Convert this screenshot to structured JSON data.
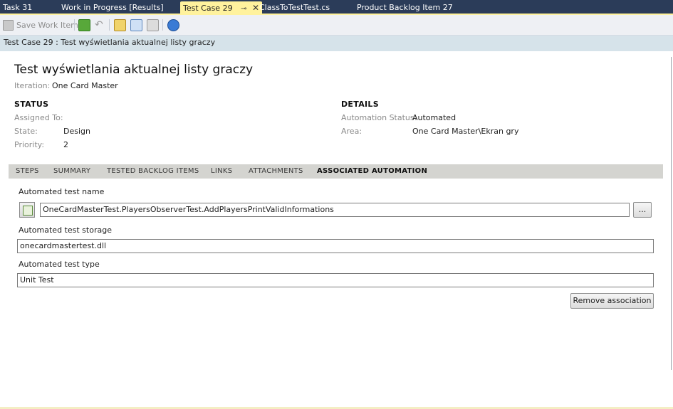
{
  "tabs": [
    {
      "label": "Task 31",
      "active": false
    },
    {
      "label": "Work in Progress [Results]",
      "active": false
    },
    {
      "label": "Test Case 29",
      "active": true
    },
    {
      "label": "ClassToTestTest.cs",
      "active": false
    },
    {
      "label": "Product Backlog Item 27",
      "active": false
    }
  ],
  "tab_icons": {
    "pin": "⊸",
    "close": "✕"
  },
  "toolbar": {
    "save_label": "Save Work Item"
  },
  "header": {
    "breadcrumb": "Test Case 29 : Test wyświetlania aktualnej listy graczy"
  },
  "work_item": {
    "title": "Test wyświetlania aktualnej listy graczy",
    "iteration_label": "Iteration:",
    "iteration_value": "One Card Master"
  },
  "status": {
    "heading": "STATUS",
    "assigned_label": "Assigned To:",
    "assigned_value": "",
    "state_label": "State:",
    "state_value": "Design",
    "priority_label": "Priority:",
    "priority_value": "2"
  },
  "details": {
    "heading": "DETAILS",
    "automation_label": "Automation Status:",
    "automation_value": "Automated",
    "area_label": "Area:",
    "area_value": "One Card Master\\Ekran gry"
  },
  "inner_tabs": [
    "STEPS",
    "SUMMARY",
    "TESTED BACKLOG ITEMS",
    "LINKS",
    "ATTACHMENTS",
    "ASSOCIATED AUTOMATION"
  ],
  "automation": {
    "name_label": "Automated test name",
    "name_value": "OneCardMasterTest.PlayersObserverTest.AddPlayersPrintValidInformations",
    "browse_label": "...",
    "storage_label": "Automated test storage",
    "storage_value": "onecardmastertest.dll",
    "type_label": "Automated test type",
    "type_value": "Unit Test",
    "remove_label": "Remove association"
  },
  "colors": {
    "tabstrip": "#2b3c59",
    "active_tab": "#fff29d",
    "title_strip": "#d6e3ea",
    "inner_tabs": "#d4d4d0"
  }
}
